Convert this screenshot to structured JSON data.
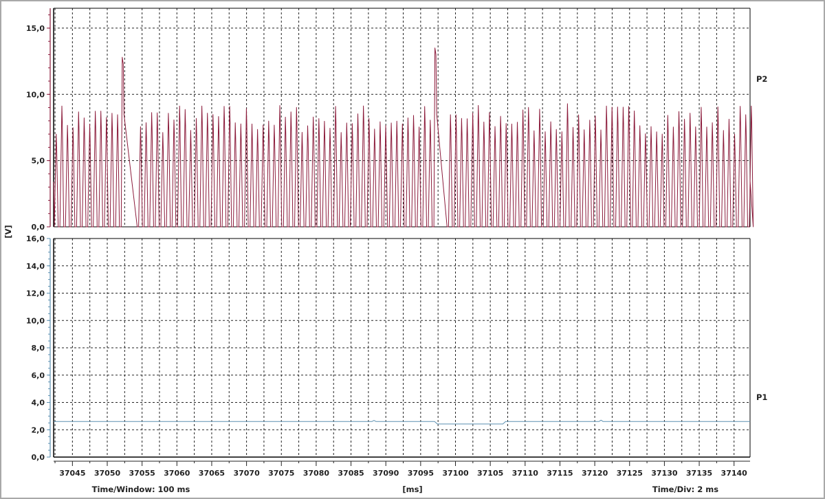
{
  "chart_data": {
    "type": "line",
    "y_unit_label": "[V]",
    "x_unit_label": "[ms]",
    "time_window_label": "Time/Window: 100 ms",
    "time_div_label": "Time/Div: 2 ms",
    "xlim": [
      37042.3,
      37142.3
    ],
    "x_ticks": [
      37045,
      37050,
      37055,
      37060,
      37065,
      37070,
      37075,
      37080,
      37085,
      37090,
      37095,
      37100,
      37105,
      37110,
      37115,
      37120,
      37125,
      37130,
      37135,
      37140
    ],
    "x_tick_labels": [
      "37045",
      "37050",
      "37055",
      "37060",
      "37065",
      "37070",
      "37075",
      "37080",
      "37085",
      "37090",
      "37095",
      "37100",
      "37105",
      "37110",
      "37115",
      "37120",
      "37125",
      "37130",
      "37135",
      "37140"
    ],
    "grid": true,
    "panels": [
      {
        "name": "P2",
        "color": "#8b1a3a",
        "ylim": [
          0,
          16.5
        ],
        "y_ticks": [
          0,
          5,
          10,
          15
        ],
        "y_tick_labels": [
          "0,0",
          "5,0",
          "10,0",
          "15,0"
        ],
        "signal": {
          "kind": "pulse-train",
          "pulse_period_ms": 0.8,
          "baseline_v": 0,
          "peak_range_v": [
            7.0,
            9.3
          ],
          "spikes": [
            {
              "t": 37052.2,
              "v": 12.8
            },
            {
              "t": 37097.3,
              "v": 13.5
            }
          ],
          "gaps": [
            [
              37052.6,
              37054.4
            ],
            [
              37097.7,
              37098.9
            ]
          ]
        }
      },
      {
        "name": "P1",
        "color": "#5b8fb0",
        "ylim": [
          0,
          16
        ],
        "y_ticks": [
          0,
          2,
          4,
          6,
          8,
          10,
          12,
          14,
          16
        ],
        "y_tick_labels": [
          "0,0",
          "2,0",
          "4,0",
          "6,0",
          "8,0",
          "10,0",
          "12,0",
          "14,0",
          "16,0"
        ],
        "x": [
          37042.3,
          37088.0,
          37088.3,
          37088.6,
          37097.0,
          37097.4,
          37106.8,
          37107.2,
          37120.6,
          37120.9,
          37121.2,
          37142.3
        ],
        "y": [
          2.6,
          2.6,
          2.68,
          2.6,
          2.6,
          2.42,
          2.42,
          2.6,
          2.6,
          2.7,
          2.6,
          2.6
        ]
      }
    ]
  }
}
